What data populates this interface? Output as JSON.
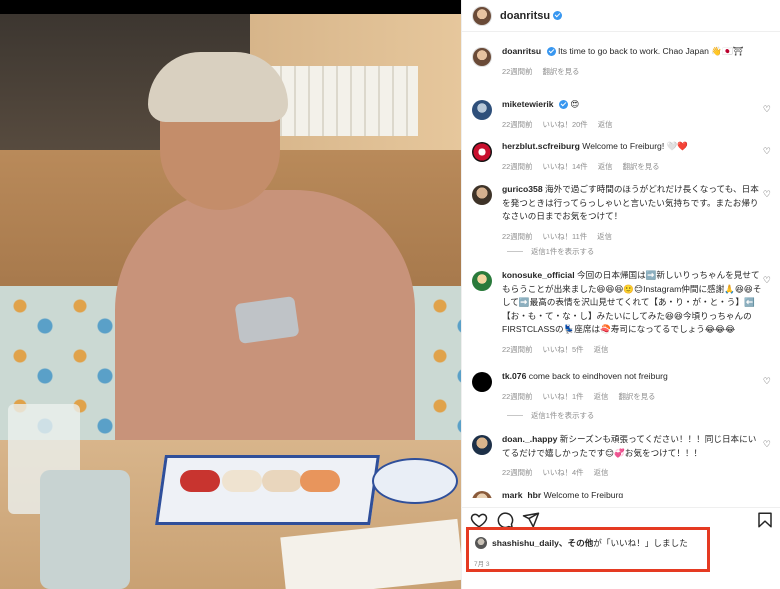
{
  "photo": {
    "description_alt": ""
  },
  "header": {
    "username": "doanritsu"
  },
  "comments": [
    {
      "username": "doanritsu",
      "text": "Its time to go back to work. Chao Japan 👋🇯🇵⛩",
      "time": "22週間前",
      "reply": "翻訳を見る",
      "has_heart": false
    },
    {
      "username": "miketewierik",
      "text": "😍",
      "time": "22週間前",
      "likes": "いいね！20件",
      "reply": "返信",
      "verified": true
    },
    {
      "username": "herzblut.scfreiburg",
      "text": "Welcome to Freiburg! 🤍❤️",
      "time": "22週間前",
      "likes": "いいね！14件",
      "reply": "返信",
      "translate": "翻訳を見る"
    },
    {
      "username": "gurico358",
      "text": "海外で過ごす時間のほうがどれだけ長くなっても、日本を発つときは行ってらっしゃいと言いたい気持ちです。またお帰りなさいの日までお気をつけて！",
      "time": "22週間前",
      "likes": "いいね！11件",
      "reply": "返信",
      "replies_toggle": "返信1件を表示する"
    },
    {
      "username": "konosuke_official",
      "text": "今回の日本帰国は➡️新しいりっちゃんを見せてもらうことが出来ました😆😆😆🙂😊Instagram仲間に感謝🙏😆😆そして➡️最高の表情を沢山見せてくれて【あ・り・が・と・う】⬅️【お・も・て・な・し】みたいにしてみた😆😆今頃りっちゃんのFIRSTCLASSの💺座席は🍣寿司になってるでしょう😂😂😂",
      "time": "22週間前",
      "likes": "いいね！5件",
      "reply": "返信"
    },
    {
      "username": "tk.076",
      "text": "come back to eindhoven not freiburg",
      "time": "22週間前",
      "likes": "いいね！1件",
      "reply": "返信",
      "translate": "翻訳を見る",
      "replies_toggle": "返信1件を表示する"
    },
    {
      "username": "doan._.happy",
      "text": "新シーズンも頑張ってください！！！同じ日本にいてるだけで嬉しかったです😊💞お気をつけて！！！",
      "time": "22週間前",
      "likes": "いいね！4件",
      "reply": "返信"
    },
    {
      "username": "mark_hbr",
      "text": "Welcome to Freiburg",
      "time": "",
      "likes": "",
      "reply": ""
    }
  ],
  "actions": {
    "like": "heart-icon",
    "comment": "comment-icon",
    "share": "share-icon",
    "save": "bookmark-icon"
  },
  "likes_summary": {
    "user": "shashishu_daily",
    "rest": "、その他",
    "suffix": "が「いいね！」しました",
    "date": "7月 3"
  },
  "colors": {
    "highlight": "#e53a22",
    "verified": "#3897f0"
  }
}
